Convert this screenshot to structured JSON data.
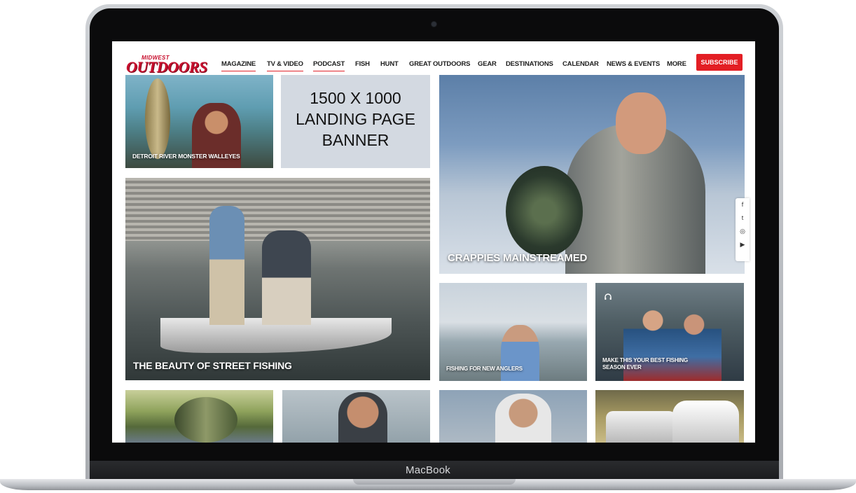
{
  "device": {
    "label": "MacBook"
  },
  "site": {
    "logo_top": "MIDWEST",
    "logo_main": "OUTDOORS",
    "nav": [
      {
        "label": "MAGAZINE",
        "active": true
      },
      {
        "label": "TV & VIDEO",
        "active": true
      },
      {
        "label": "PODCAST",
        "active": true
      },
      {
        "label": "FISH",
        "active": false
      },
      {
        "label": "HUNT",
        "active": false
      },
      {
        "label": "GREAT OUTDOORS",
        "active": false
      },
      {
        "label": "GEAR",
        "active": false
      },
      {
        "label": "DESTINATIONS",
        "active": false
      },
      {
        "label": "CALENDAR",
        "active": false
      },
      {
        "label": "NEWS & EVENTS",
        "active": false
      },
      {
        "label": "MORE",
        "active": false
      }
    ],
    "subscribe_label": "SUBSCRIBE",
    "accent_color": "#e31e24"
  },
  "banner": {
    "line1": "1500 X 1000",
    "line2": "LANDING PAGE",
    "line3": "BANNER"
  },
  "tiles": {
    "walleyes": "DETROIT RIVER MONSTER WALLEYES",
    "crappies": "CRAPPIES MAINSTREAMED",
    "street": "THE BEAUTY OF STREET FISHING",
    "anglers": "FISHING FOR NEW ANGLERS",
    "season_line1": "MAKE THIS YOUR BEST FISHING",
    "season_line2": "SEASON EVER"
  },
  "social": {
    "facebook": "f",
    "twitter": "t",
    "instagram": "◎",
    "youtube": "▶"
  }
}
